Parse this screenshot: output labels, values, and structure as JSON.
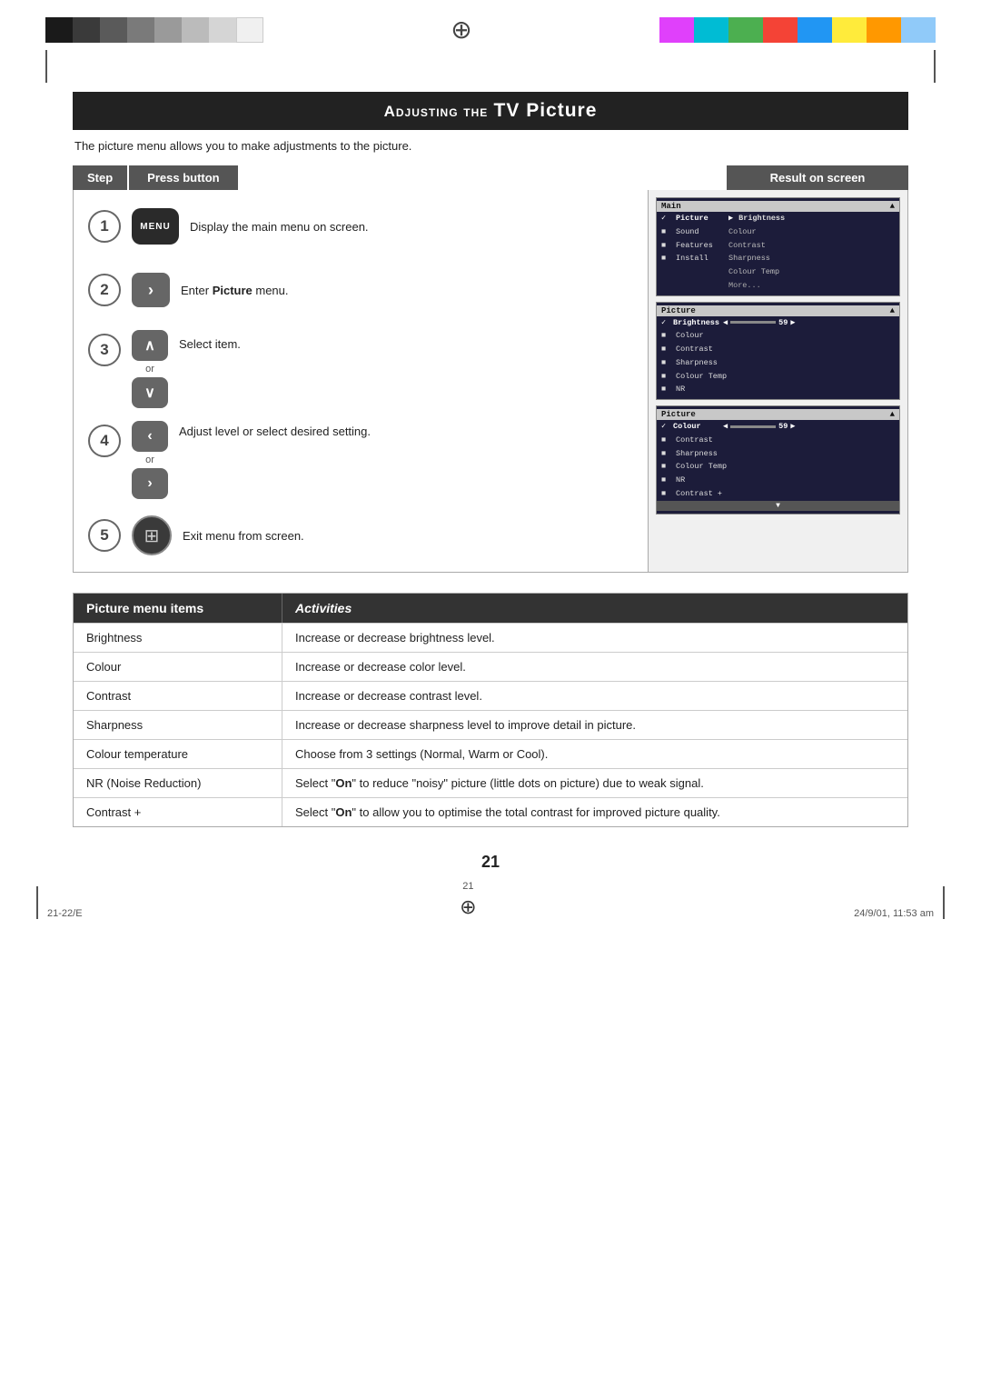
{
  "page": {
    "title": "Adjusting the TV Picture",
    "title_prefix": "Adjusting the",
    "title_main": "TV Picture",
    "subtitle": "The picture menu allows you to make adjustments to the picture.",
    "page_number": "21",
    "footer_left": "21-22/E",
    "footer_center": "21",
    "footer_right": "24/9/01, 11:53 am"
  },
  "step_header": {
    "step_label": "Step",
    "press_label": "Press button",
    "result_label": "Result on screen"
  },
  "steps": [
    {
      "number": "1",
      "button": "MENU",
      "description": "Display the main menu on screen."
    },
    {
      "number": "2",
      "button": "›",
      "description": "Enter Picture menu."
    },
    {
      "number": "3",
      "button_top": "∧",
      "button_bottom": "∨",
      "description": "Select item.",
      "or": "or"
    },
    {
      "number": "4",
      "button_top": "‹",
      "button_bottom": "›",
      "description": "Adjust level or select desired setting.",
      "or": "or"
    },
    {
      "number": "5",
      "button": "⊞",
      "description": "Exit menu from screen."
    }
  ],
  "screen_menus": {
    "menu1": {
      "title": "Main",
      "title_arrow": "▲",
      "items": [
        {
          "marker": "✓",
          "name": "Picture",
          "arrow": "▶",
          "sub": "Brightness"
        },
        {
          "marker": "■",
          "name": "Sound",
          "sub": "Colour"
        },
        {
          "marker": "■",
          "name": "Features",
          "sub": "Contrast"
        },
        {
          "marker": "■",
          "name": "Install",
          "sub": "Sharpness"
        },
        {
          "marker": "",
          "name": "",
          "sub": "Colour Temp"
        },
        {
          "marker": "",
          "name": "",
          "sub": "More..."
        }
      ]
    },
    "menu2": {
      "title": "Picture",
      "title_arrow": "▲",
      "items": [
        {
          "marker": "✓",
          "name": "Brightness",
          "slider": true,
          "value": "59"
        },
        {
          "marker": "■",
          "name": "Colour"
        },
        {
          "marker": "■",
          "name": "Contrast"
        },
        {
          "marker": "■",
          "name": "Sharpness"
        },
        {
          "marker": "■",
          "name": "Colour Temp"
        },
        {
          "marker": "■",
          "name": "NR"
        }
      ]
    },
    "menu3": {
      "title": "Picture",
      "title_arrow": "▲",
      "items": [
        {
          "marker": "✓",
          "name": "Colour",
          "slider": true,
          "value": "59"
        },
        {
          "marker": "■",
          "name": "Contrast"
        },
        {
          "marker": "■",
          "name": "Sharpness"
        },
        {
          "marker": "■",
          "name": "Colour Temp"
        },
        {
          "marker": "■",
          "name": "NR"
        },
        {
          "marker": "■",
          "name": "Contrast +"
        }
      ],
      "bottom_arrow": "▼"
    }
  },
  "picture_menu": {
    "col1_header": "Picture menu items",
    "col2_header": "Activities",
    "rows": [
      {
        "item": "Brightness",
        "activity": "Increase or decrease brightness level."
      },
      {
        "item": "Colour",
        "activity": "Increase or decrease color level."
      },
      {
        "item": "Contrast",
        "activity": "Increase or decrease contrast level."
      },
      {
        "item": "Sharpness",
        "activity": "Increase or decrease sharpness level to improve detail in picture."
      },
      {
        "item": "Colour temperature",
        "activity": "Choose from 3 settings (Normal, Warm or Cool)."
      },
      {
        "item": "NR (Noise Reduction)",
        "activity": "Select \"On\" to reduce \"noisy\" picture (little dots on picture) due to weak signal."
      },
      {
        "item": "Contrast +",
        "activity": "Select \"On\" to allow you to optimise the total contrast for improved picture quality."
      }
    ]
  }
}
